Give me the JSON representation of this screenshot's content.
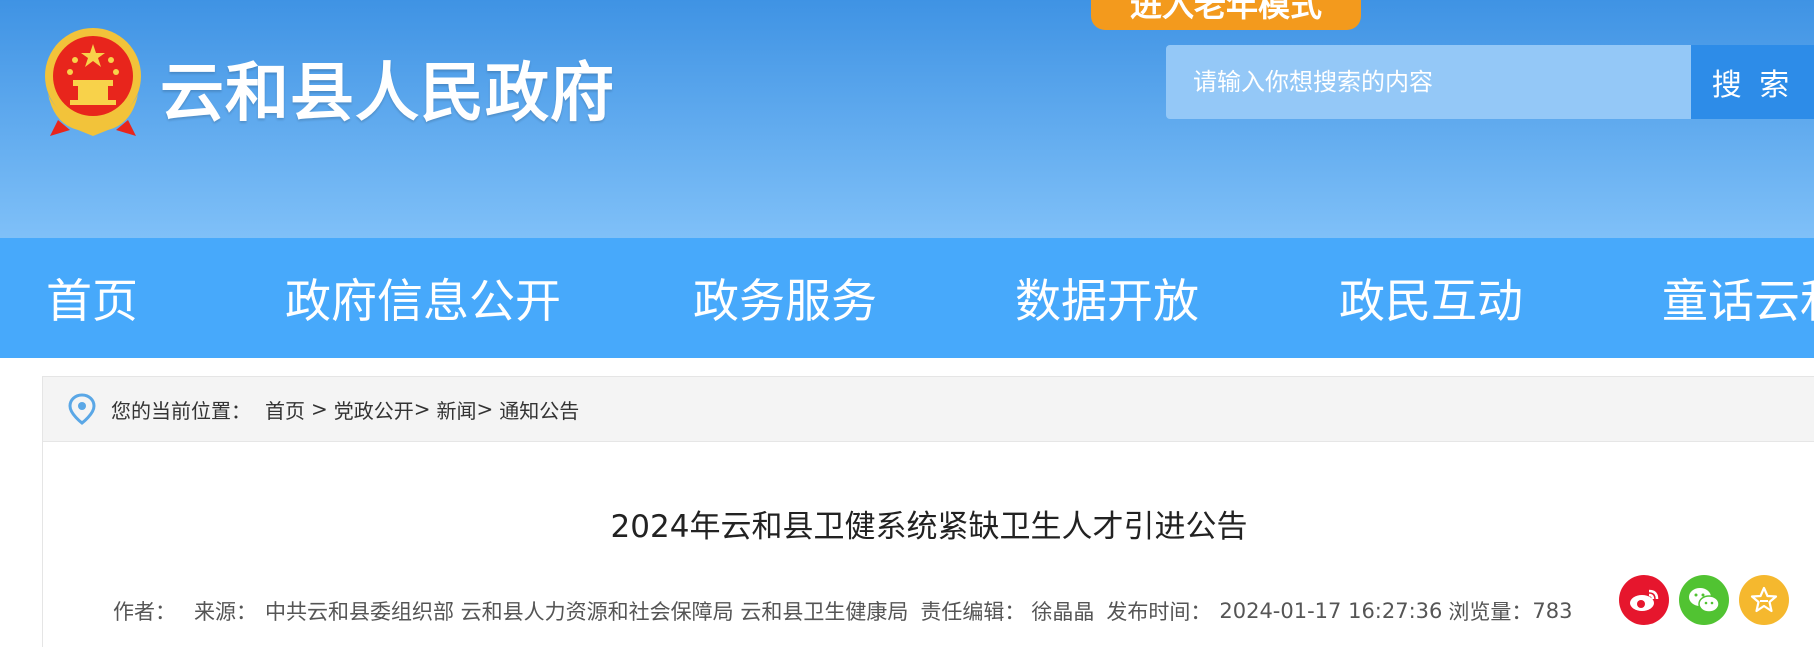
{
  "header": {
    "site_title": "云和县人民政府",
    "elder_mode_label": "进入老年模式",
    "search_placeholder": "请输入你想搜索的内容",
    "search_button": "搜 索"
  },
  "nav": {
    "items": [
      {
        "label": "首页"
      },
      {
        "label": "政府信息公开"
      },
      {
        "label": "政务服务"
      },
      {
        "label": "数据开放"
      },
      {
        "label": "政民互动"
      },
      {
        "label": "童话云和"
      }
    ]
  },
  "breadcrumb": {
    "prefix": "您的当前位置：",
    "items": [
      "首页",
      "党政公开",
      "新闻",
      "通知公告"
    ],
    "sep": ">"
  },
  "article": {
    "title": "2024年云和县卫健系统紧缺卫生人才引进公告",
    "author_label": "作者：",
    "source_label": "来源：",
    "source_value": "中共云和县委组织部 云和县人力资源和社会保障局 云和县卫生健康局",
    "editor_label": "责任编辑：",
    "editor_value": "徐晶晶",
    "publish_label": "发布时间：",
    "publish_value": "2024-01-17 16:27:36",
    "views_label": "浏览量：",
    "views_value": "783"
  },
  "share": {
    "weibo_color": "#e6162d",
    "wechat_color": "#51c332",
    "favorite_color": "#f5b82e"
  }
}
